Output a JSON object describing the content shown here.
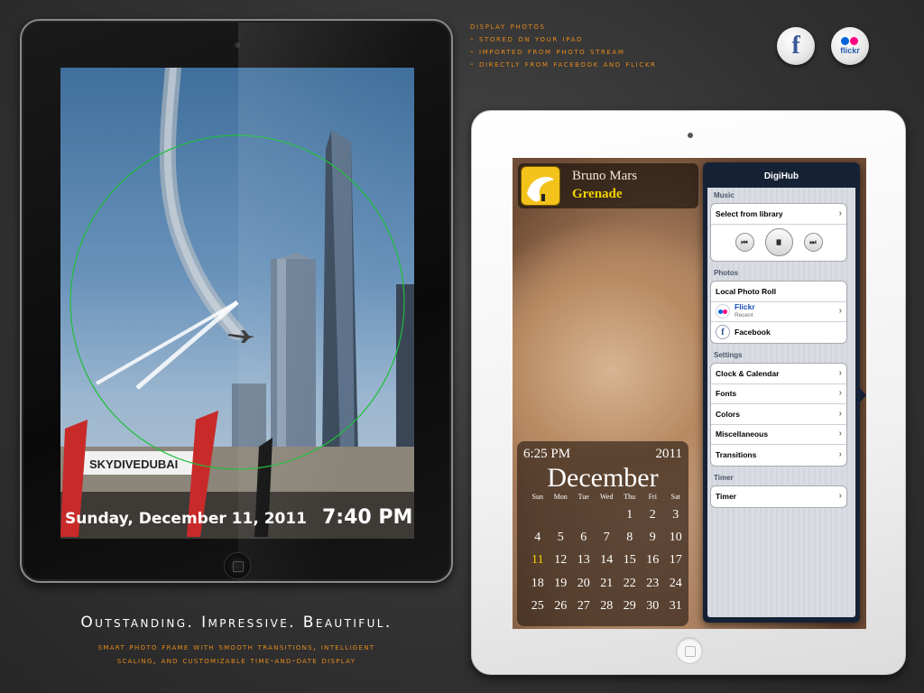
{
  "promo": {
    "lines": [
      "display photos",
      "- stored on your iPad",
      "- imported from photo stream",
      "- directly from facebook and flickr"
    ],
    "headline": "Outstanding. Impressive. Beautiful.",
    "subtext_line1": "smart photo frame with smooth transitions, intelligent",
    "subtext_line2": "scaling, and customizable time-and-date display"
  },
  "social": {
    "facebook_glyph": "f",
    "flickr_word": "flickr"
  },
  "left_device": {
    "photo_banner_text": "SKYDIVEDUBAI",
    "date_text": "Sunday, December 11, 2011",
    "time_text": "7:40 PM"
  },
  "right_device": {
    "now_playing": {
      "artist": "Bruno Mars",
      "song": "Grenade"
    },
    "calendar": {
      "time": "6:25 PM",
      "year": "2011",
      "month": "December",
      "weekdays": [
        "Sun",
        "Mon",
        "Tue",
        "Wed",
        "Thu",
        "Fri",
        "Sat"
      ],
      "today": "11",
      "rows": [
        [
          "",
          "",
          "",
          "",
          "1",
          "2",
          "3"
        ],
        [
          "4",
          "5",
          "6",
          "7",
          "8",
          "9",
          "10"
        ],
        [
          "11",
          "12",
          "13",
          "14",
          "15",
          "16",
          "17"
        ],
        [
          "18",
          "19",
          "20",
          "21",
          "22",
          "23",
          "24"
        ],
        [
          "25",
          "26",
          "27",
          "28",
          "29",
          "30",
          "31"
        ]
      ]
    },
    "menu": {
      "title": "DigiHub",
      "music_header": "Music",
      "select_library": "Select from library",
      "photos_header": "Photos",
      "local_roll": "Local Photo Roll",
      "flickr": "Flickr",
      "flickr_sub": "Recent",
      "facebook": "Facebook",
      "settings_header": "Settings",
      "settings_items": [
        "Clock & Calendar",
        "Fonts",
        "Colors",
        "Miscellaneous",
        "Transitions"
      ],
      "timer_header": "Timer",
      "timer": "Timer"
    }
  },
  "colors": {
    "accent_orange": "#e58a1c",
    "facebook_blue": "#3b5998",
    "flickr_blue": "#0063dc",
    "flickr_pink": "#ff0084",
    "clock_ring_green": "#1fbf3a",
    "today_yellow": "#f4d300"
  }
}
